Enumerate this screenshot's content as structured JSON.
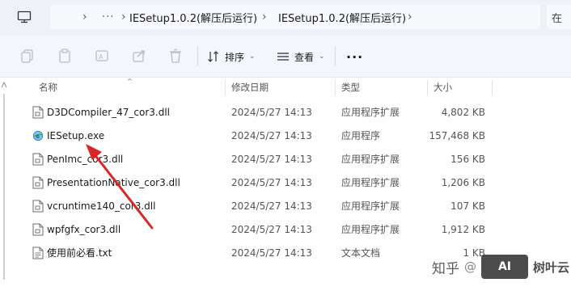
{
  "address_bar": {
    "breadcrumbs": [
      "IESetup1.0.2(解压后运行)",
      "IESetup1.0.2(解压后运行)"
    ],
    "search_placeholder": "在"
  },
  "toolbar": {
    "sort_label": "排序",
    "view_label": "查看",
    "more_label": "···"
  },
  "columns": {
    "name": "名称",
    "modified": "修改日期",
    "type": "类型",
    "size": "大小"
  },
  "files": [
    {
      "name": "D3DCompiler_47_cor3.dll",
      "modified": "2024/5/27 14:13",
      "type": "应用程序扩展",
      "size": "4,802 KB",
      "icon": "dll-file-icon"
    },
    {
      "name": "IESetup.exe",
      "modified": "2024/5/27 14:13",
      "type": "应用程序",
      "size": "157,468 KB",
      "icon": "ie-exe-icon"
    },
    {
      "name": "PenImc_cor3.dll",
      "modified": "2024/5/27 14:13",
      "type": "应用程序扩展",
      "size": "156 KB",
      "icon": "dll-file-icon"
    },
    {
      "name": "PresentationNative_cor3.dll",
      "modified": "2024/5/27 14:13",
      "type": "应用程序扩展",
      "size": "1,206 KB",
      "icon": "dll-file-icon"
    },
    {
      "name": "vcruntime140_cor3.dll",
      "modified": "2024/5/27 14:13",
      "type": "应用程序扩展",
      "size": "107 KB",
      "icon": "dll-file-icon"
    },
    {
      "name": "wpfgfx_cor3.dll",
      "modified": "2024/5/27 14:13",
      "type": "应用程序扩展",
      "size": "1,912 KB",
      "icon": "dll-file-icon"
    },
    {
      "name": "使用前必看.txt",
      "modified": "2024/5/27 14:13",
      "type": "文本文档",
      "size": "1 KB",
      "icon": "txt-file-icon"
    }
  ],
  "watermark": {
    "site": "知乎",
    "at": "@",
    "badge": "AI",
    "author": "树叶云"
  },
  "colors": {
    "arrow": "#d62828",
    "toolbar_bg": "#f3f6fb",
    "address_bg": "#eef2f8"
  }
}
